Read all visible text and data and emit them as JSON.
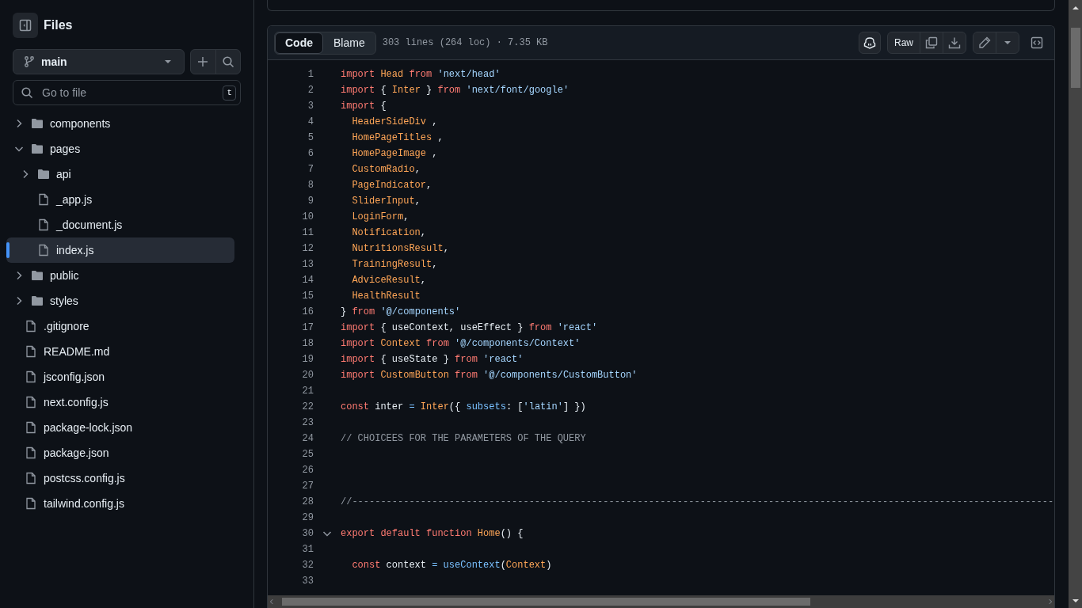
{
  "sidebar": {
    "title": "Files",
    "branch": "main",
    "search": {
      "placeholder": "Go to file",
      "shortcut": "t"
    },
    "tree": [
      {
        "kind": "folder",
        "name": "components",
        "expanded": false,
        "selected": false
      },
      {
        "kind": "folder",
        "name": "pages",
        "expanded": true,
        "selected": false,
        "children": [
          {
            "kind": "folder",
            "name": "api",
            "expanded": false,
            "selected": false
          },
          {
            "kind": "file",
            "name": "_app.js",
            "selected": false
          },
          {
            "kind": "file",
            "name": "_document.js",
            "selected": false
          },
          {
            "kind": "file",
            "name": "index.js",
            "selected": true
          }
        ]
      },
      {
        "kind": "folder",
        "name": "public",
        "expanded": false,
        "selected": false
      },
      {
        "kind": "folder",
        "name": "styles",
        "expanded": false,
        "selected": false
      },
      {
        "kind": "file",
        "name": ".gitignore",
        "selected": false
      },
      {
        "kind": "file",
        "name": "README.md",
        "selected": false
      },
      {
        "kind": "file",
        "name": "jsconfig.json",
        "selected": false
      },
      {
        "kind": "file",
        "name": "next.config.js",
        "selected": false
      },
      {
        "kind": "file",
        "name": "package-lock.json",
        "selected": false
      },
      {
        "kind": "file",
        "name": "package.json",
        "selected": false
      },
      {
        "kind": "file",
        "name": "postcss.config.js",
        "selected": false
      },
      {
        "kind": "file",
        "name": "tailwind.config.js",
        "selected": false
      }
    ]
  },
  "file_view": {
    "tabs": [
      {
        "label": "Code",
        "selected": true
      },
      {
        "label": "Blame",
        "selected": false
      }
    ],
    "info": "303 lines (264 loc) · 7.35 KB",
    "raw_button": "Raw",
    "lines": [
      {
        "number": "1",
        "foldable": false,
        "tokens": [
          {
            "kind": "keyword",
            "text": "import "
          },
          {
            "kind": "entity",
            "text": "Head "
          },
          {
            "kind": "keyword",
            "text": "from "
          },
          {
            "kind": "string",
            "text": "'next/head'"
          }
        ]
      },
      {
        "number": "2",
        "foldable": false,
        "tokens": [
          {
            "kind": "keyword",
            "text": "import "
          },
          {
            "kind": "plain",
            "text": "{ "
          },
          {
            "kind": "entity",
            "text": "Inter "
          },
          {
            "kind": "plain",
            "text": "} "
          },
          {
            "kind": "keyword",
            "text": "from "
          },
          {
            "kind": "string",
            "text": "'next/font/google'"
          }
        ]
      },
      {
        "number": "3",
        "foldable": false,
        "tokens": [
          {
            "kind": "keyword",
            "text": "import "
          },
          {
            "kind": "plain",
            "text": "{"
          }
        ]
      },
      {
        "number": "4",
        "foldable": false,
        "tokens": [
          {
            "kind": "entity",
            "text": "  HeaderSideDiv "
          },
          {
            "kind": "plain",
            "text": ","
          }
        ]
      },
      {
        "number": "5",
        "foldable": false,
        "tokens": [
          {
            "kind": "entity",
            "text": "  HomePageTitles "
          },
          {
            "kind": "plain",
            "text": ","
          }
        ]
      },
      {
        "number": "6",
        "foldable": false,
        "tokens": [
          {
            "kind": "entity",
            "text": "  HomePageImage "
          },
          {
            "kind": "plain",
            "text": ","
          }
        ]
      },
      {
        "number": "7",
        "foldable": false,
        "tokens": [
          {
            "kind": "entity",
            "text": "  CustomRadio"
          },
          {
            "kind": "plain",
            "text": ","
          }
        ]
      },
      {
        "number": "8",
        "foldable": false,
        "tokens": [
          {
            "kind": "entity",
            "text": "  PageIndicator"
          },
          {
            "kind": "plain",
            "text": ","
          }
        ]
      },
      {
        "number": "9",
        "foldable": false,
        "tokens": [
          {
            "kind": "entity",
            "text": "  SliderInput"
          },
          {
            "kind": "plain",
            "text": ","
          }
        ]
      },
      {
        "number": "10",
        "foldable": false,
        "tokens": [
          {
            "kind": "entity",
            "text": "  LoginForm"
          },
          {
            "kind": "plain",
            "text": ","
          }
        ]
      },
      {
        "number": "11",
        "foldable": false,
        "tokens": [
          {
            "kind": "entity",
            "text": "  Notification"
          },
          {
            "kind": "plain",
            "text": ","
          }
        ]
      },
      {
        "number": "12",
        "foldable": false,
        "tokens": [
          {
            "kind": "entity",
            "text": "  NutritionsResult"
          },
          {
            "kind": "plain",
            "text": ","
          }
        ]
      },
      {
        "number": "13",
        "foldable": false,
        "tokens": [
          {
            "kind": "entity",
            "text": "  TrainingResult"
          },
          {
            "kind": "plain",
            "text": ","
          }
        ]
      },
      {
        "number": "14",
        "foldable": false,
        "tokens": [
          {
            "kind": "entity",
            "text": "  AdviceResult"
          },
          {
            "kind": "plain",
            "text": ","
          }
        ]
      },
      {
        "number": "15",
        "foldable": false,
        "tokens": [
          {
            "kind": "entity",
            "text": "  HealthResult"
          }
        ]
      },
      {
        "number": "16",
        "foldable": false,
        "tokens": [
          {
            "kind": "plain",
            "text": "} "
          },
          {
            "kind": "keyword",
            "text": "from "
          },
          {
            "kind": "string",
            "text": "'@/components'"
          }
        ]
      },
      {
        "number": "17",
        "foldable": false,
        "tokens": [
          {
            "kind": "keyword",
            "text": "import "
          },
          {
            "kind": "plain",
            "text": "{ useContext, useEffect } "
          },
          {
            "kind": "keyword",
            "text": "from "
          },
          {
            "kind": "string",
            "text": "'react'"
          }
        ]
      },
      {
        "number": "18",
        "foldable": false,
        "tokens": [
          {
            "kind": "keyword",
            "text": "import "
          },
          {
            "kind": "entity",
            "text": "Context "
          },
          {
            "kind": "keyword",
            "text": "from "
          },
          {
            "kind": "string",
            "text": "'@/components/Context'"
          }
        ]
      },
      {
        "number": "19",
        "foldable": false,
        "tokens": [
          {
            "kind": "keyword",
            "text": "import "
          },
          {
            "kind": "plain",
            "text": "{ useState } "
          },
          {
            "kind": "keyword",
            "text": "from "
          },
          {
            "kind": "string",
            "text": "'react'"
          }
        ]
      },
      {
        "number": "20",
        "foldable": false,
        "tokens": [
          {
            "kind": "keyword",
            "text": "import "
          },
          {
            "kind": "entity",
            "text": "CustomButton "
          },
          {
            "kind": "keyword",
            "text": "from "
          },
          {
            "kind": "string",
            "text": "'@/components/CustomButton'"
          }
        ]
      },
      {
        "number": "21",
        "foldable": false
      },
      {
        "number": "22",
        "foldable": false,
        "tokens": [
          {
            "kind": "keyword",
            "text": "const "
          },
          {
            "kind": "plain",
            "text": "inter "
          },
          {
            "kind": "constant",
            "text": "= "
          },
          {
            "kind": "entity",
            "text": "Inter"
          },
          {
            "kind": "plain",
            "text": "({ "
          },
          {
            "kind": "constant",
            "text": "subsets"
          },
          {
            "kind": "plain",
            "text": ": ["
          },
          {
            "kind": "string",
            "text": "'latin'"
          },
          {
            "kind": "plain",
            "text": "] })"
          }
        ]
      },
      {
        "number": "23",
        "foldable": false
      },
      {
        "number": "24",
        "foldable": false,
        "tokens": [
          {
            "kind": "comment",
            "text": "// CHOICEES FOR THE PARAMETERS OF THE QUERY"
          }
        ]
      },
      {
        "number": "25",
        "foldable": false
      },
      {
        "number": "26",
        "foldable": false
      },
      {
        "number": "27",
        "foldable": false
      },
      {
        "number": "28",
        "foldable": false,
        "tokens": [
          {
            "kind": "comment",
            "text": "//---------------------------------------------------------------------------------------------------------------------------"
          }
        ]
      },
      {
        "number": "29",
        "foldable": false
      },
      {
        "number": "30",
        "foldable": true,
        "tokens": [
          {
            "kind": "keyword",
            "text": "export default function "
          },
          {
            "kind": "entity",
            "text": "Home"
          },
          {
            "kind": "plain",
            "text": "() {"
          }
        ]
      },
      {
        "number": "31",
        "foldable": false
      },
      {
        "number": "32",
        "foldable": false,
        "tokens": [
          {
            "kind": "keyword",
            "text": "  const "
          },
          {
            "kind": "plain",
            "text": "context "
          },
          {
            "kind": "constant",
            "text": "= useContext"
          },
          {
            "kind": "plain",
            "text": "("
          },
          {
            "kind": "entity",
            "text": "Context"
          },
          {
            "kind": "plain",
            "text": ")"
          }
        ]
      },
      {
        "number": "33",
        "foldable": false
      }
    ]
  }
}
